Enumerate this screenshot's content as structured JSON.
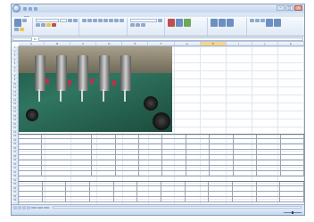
{
  "window": {
    "title": "",
    "controls": {
      "minimize": "–",
      "maximize": "□",
      "close": "×"
    }
  },
  "ribbon": {
    "groups": []
  },
  "formula_bar": {
    "fx": "fx"
  },
  "columns": [
    "A",
    "B",
    "C",
    "D",
    "E",
    "F",
    "G",
    "H",
    "I",
    "J",
    "K"
  ],
  "rows": [
    "1",
    "2",
    "3",
    "4",
    "5",
    "6",
    "7",
    "8",
    "9",
    "10",
    "11",
    "12",
    "13",
    "14",
    "15",
    "16",
    "17",
    "18",
    "19",
    "20",
    "21",
    "22",
    "23",
    "24",
    "25",
    "26",
    "27",
    "28",
    "29",
    "30",
    "31",
    "32",
    "33",
    "34",
    "35",
    "36",
    "37",
    "38",
    "39"
  ],
  "colors": {
    "window_frame": "#8a9bb5",
    "ribbon": "#dfe9f5",
    "selected_column": "#f6d58a",
    "pcb_green": "#2f7560"
  },
  "image": {
    "semantic": "circuit-board-photo"
  },
  "sheet_tabs": [],
  "status": {
    "text": ""
  }
}
